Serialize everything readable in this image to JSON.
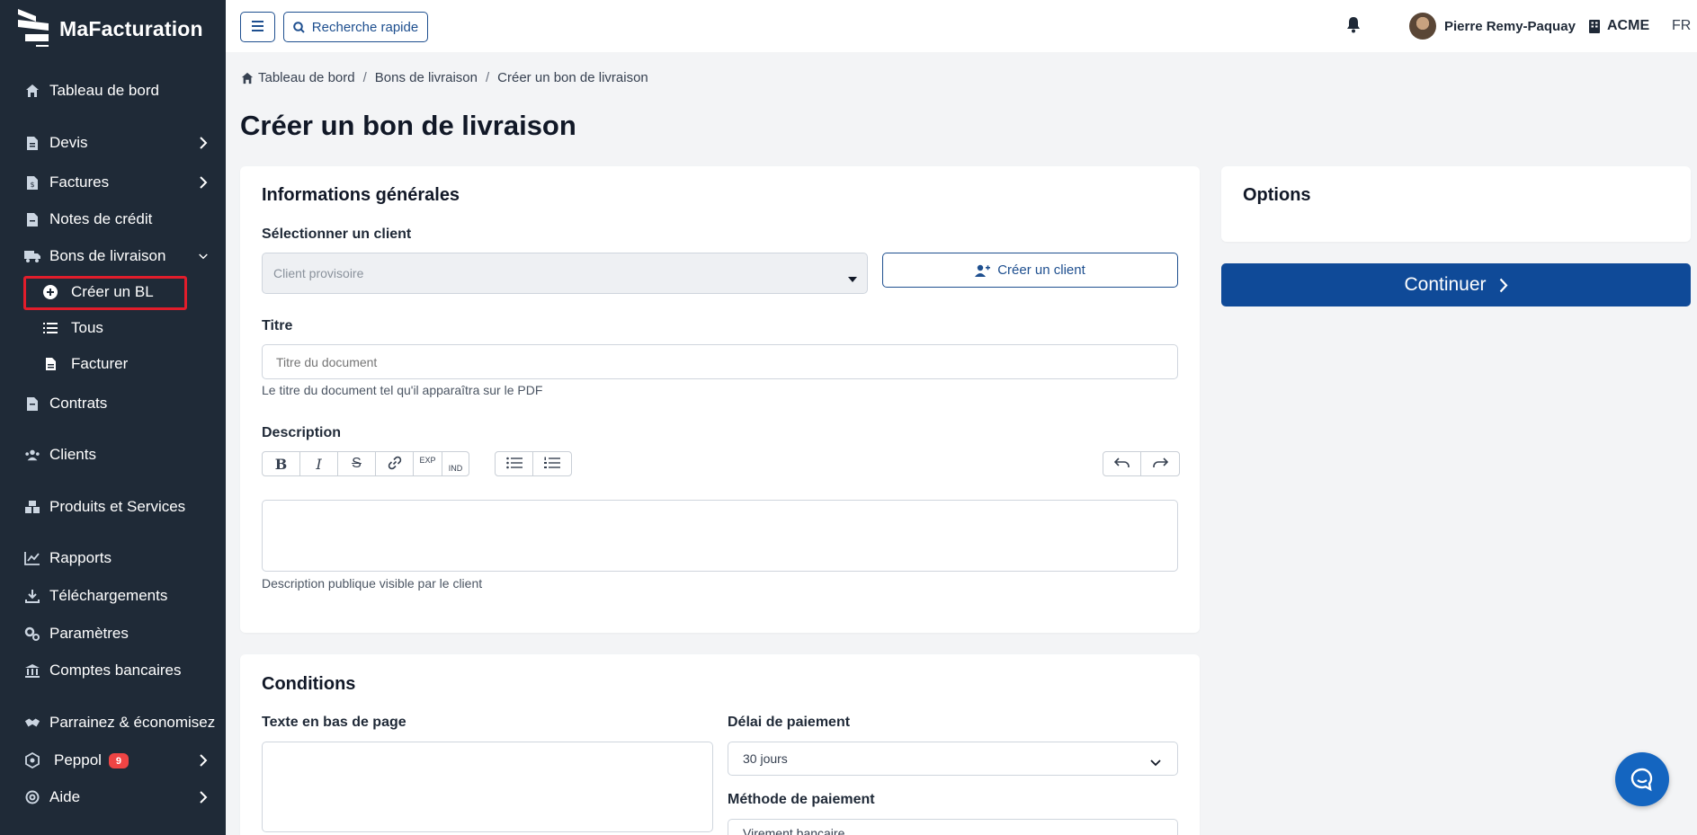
{
  "app": {
    "name": "MaFacturation"
  },
  "sidebar": {
    "items": [
      {
        "label": "Tableau de bord"
      },
      {
        "label": "Devis"
      },
      {
        "label": "Factures"
      },
      {
        "label": "Notes de crédit"
      },
      {
        "label": "Bons de livraison"
      },
      {
        "label": "Contrats"
      },
      {
        "label": "Clients"
      },
      {
        "label": "Produits et Services"
      },
      {
        "label": "Rapports"
      },
      {
        "label": "Téléchargements"
      },
      {
        "label": "Paramètres"
      },
      {
        "label": "Comptes bancaires"
      },
      {
        "label": "Parrainez & économisez"
      },
      {
        "label": "Peppol",
        "badge": "9"
      },
      {
        "label": "Aide"
      }
    ],
    "subitems": [
      {
        "label": "Créer un BL"
      },
      {
        "label": "Tous"
      },
      {
        "label": "Facturer"
      }
    ]
  },
  "topbar": {
    "search_label": "Recherche rapide",
    "user_name": "Pierre Remy-Paquay",
    "company": "ACME",
    "language": "FR"
  },
  "breadcrumb": {
    "items": [
      "Tableau de bord",
      "Bons de livraison",
      "Créer un bon de livraison"
    ],
    "separator": "/"
  },
  "page": {
    "title": "Créer un bon de livraison"
  },
  "general": {
    "title": "Informations générales",
    "client_label": "Sélectionner un client",
    "client_placeholder": "Client provisoire",
    "create_client_label": "Créer un client",
    "title_label": "Titre",
    "title_placeholder": "Titre du document",
    "title_help": "Le titre du document tel qu'il apparaîtra sur le PDF",
    "description_label": "Description",
    "description_help": "Description publique visible par le client",
    "toolbar": {
      "sup": "EXP",
      "sub": "IND"
    }
  },
  "conditions": {
    "title": "Conditions",
    "footer_label": "Texte en bas de page",
    "payment_delay_label": "Délai de paiement",
    "payment_delay_value": "30 jours",
    "payment_method_label": "Méthode de paiement",
    "payment_method_value": "Virement bancaire"
  },
  "options": {
    "title": "Options"
  },
  "actions": {
    "continue_label": "Continuer"
  },
  "colors": {
    "sidebar_bg": "#1f2a37",
    "primary": "#0f4a98",
    "highlight": "#e11d2b"
  }
}
